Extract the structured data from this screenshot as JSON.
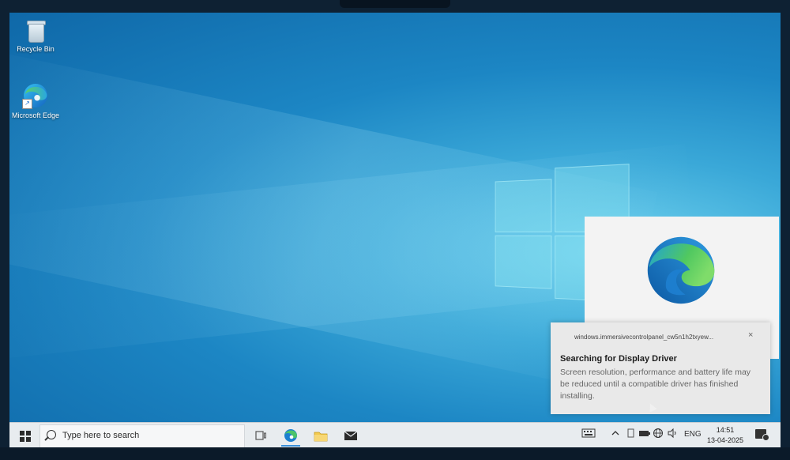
{
  "desktop": {
    "icons": [
      {
        "label": "Recycle Bin"
      },
      {
        "label": "Microsoft Edge"
      }
    ]
  },
  "toast": {
    "source": "windows.immersivecontrolpanel_cw5n1h2txyew...",
    "close_glyph": "×",
    "title": "Searching for Display Driver",
    "body": "Screen resolution, performance and battery life may be reduced until a compatible driver has finished installing."
  },
  "taskbar": {
    "search_placeholder": "Type here to search",
    "pinned": [
      "task-view-icon",
      "edge-icon",
      "file-explorer-icon",
      "mail-icon"
    ],
    "tray": {
      "language": "ENG",
      "time": "14:51",
      "date": "13-04-2025"
    }
  },
  "colors": {
    "accent": "#3a8fd8",
    "taskbar": "#e8ecef",
    "toast_bg": "#e9e9e9"
  }
}
